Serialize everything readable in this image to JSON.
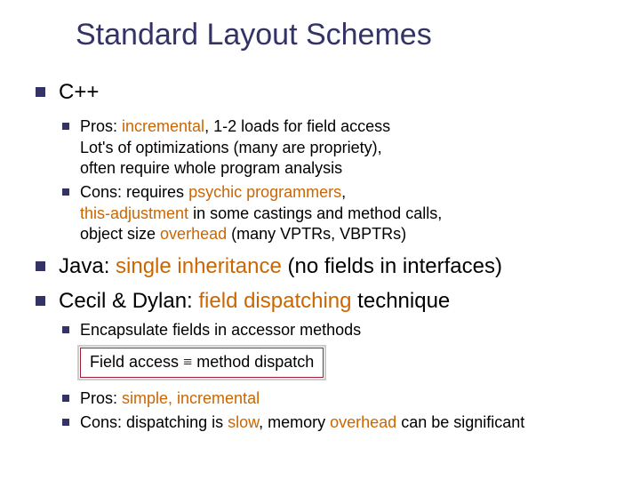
{
  "title": "Standard Layout Schemes",
  "items": [
    {
      "label": "C++",
      "sub": [
        {
          "pre": "Pros: ",
          "hl1": "incremental",
          "mid": ", 1-2 loads for field access\nLot's of optimizations (many are propriety),\noften require whole program analysis"
        },
        {
          "pre": "Cons: requires ",
          "hl1": "psychic programmers",
          "mid1": ",\n",
          "hl2": "this-adjustment",
          "mid2": " in some castings and method calls,\nobject size ",
          "hl3": "overhead",
          "tail": " (many VPTRs, VBPTRs)"
        }
      ]
    },
    {
      "pre": "Java: ",
      "hl1": "single inheritance",
      "tail": " (no fields in interfaces)"
    },
    {
      "pre": "Cecil & Dylan: ",
      "hl1": "field dispatching",
      "tail": " technique",
      "sub": [
        {
          "txt": "Encapsulate fields in accessor methods"
        }
      ],
      "box": {
        "left": "Field access ",
        "sym": "≡",
        "right": " method dispatch"
      },
      "sub2": [
        {
          "pre": "Pros: ",
          "hl1": "simple, incremental"
        },
        {
          "pre": "Cons: dispatching is ",
          "hl1": "slow",
          "mid": ", memory ",
          "hl2": "overhead",
          "tail": " can be significant"
        }
      ]
    }
  ]
}
